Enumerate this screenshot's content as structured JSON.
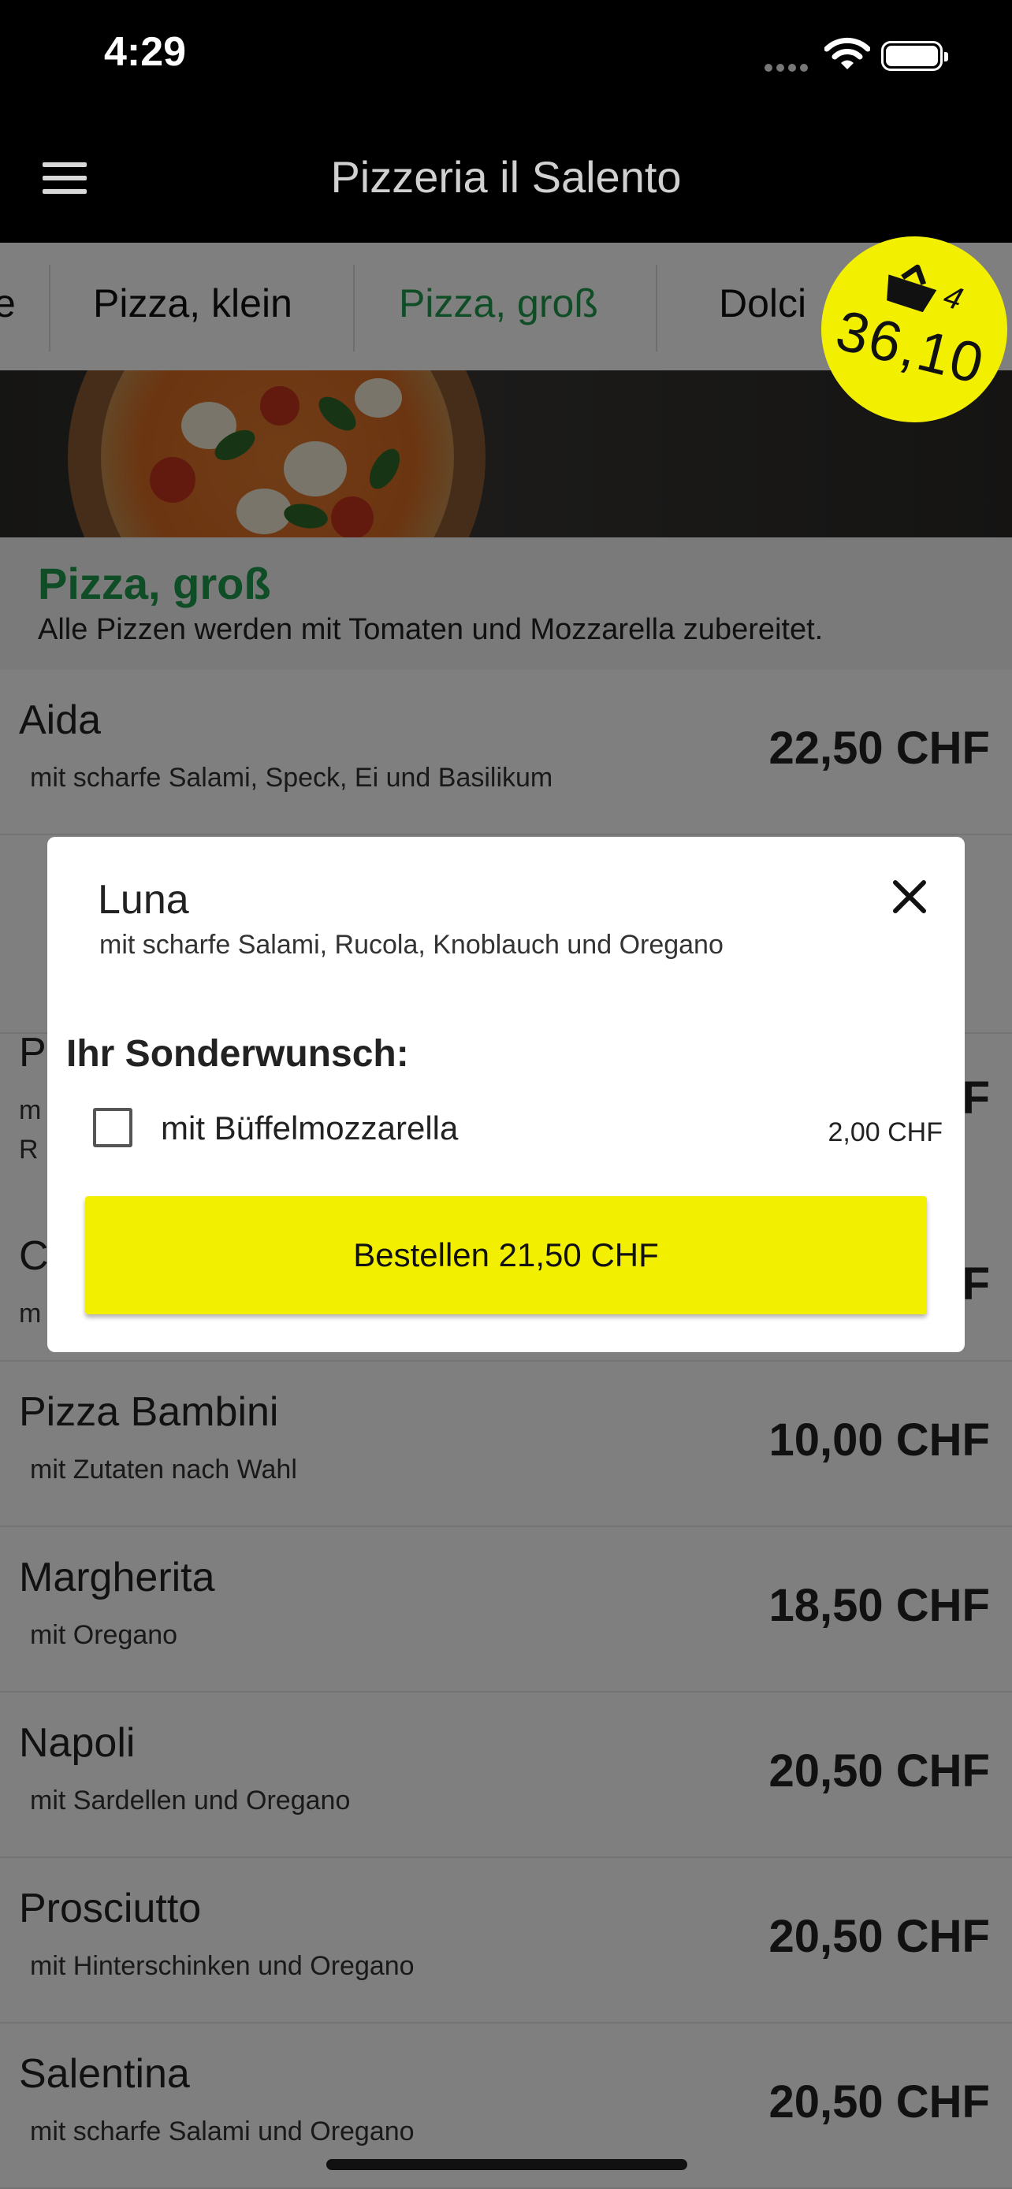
{
  "status_bar": {
    "time": "4:29"
  },
  "app_bar": {
    "title": "Pizzeria il Salento"
  },
  "tabs": [
    {
      "label": "e"
    },
    {
      "label": "Pizza, klein"
    },
    {
      "label": "Pizza, groß"
    },
    {
      "label": "Dolci"
    }
  ],
  "active_tab": 2,
  "cart": {
    "count": "4",
    "total": "36,10"
  },
  "category": {
    "name": "Pizza, groß",
    "description": "Alle Pizzen werden mit Tomaten und Mozzarella zubereitet."
  },
  "menu_items": [
    {
      "name": "Aida",
      "description": "mit scharfe Salami, Speck, Ei und Basilikum",
      "price": "22,50 CHF"
    },
    {
      "name": "P",
      "description": "m",
      "description2": "R",
      "price": "F"
    },
    {
      "name": "C",
      "description": "m",
      "price": "F"
    },
    {
      "name": "Pizza Bambini",
      "description": "mit Zutaten nach Wahl",
      "price": "10,00 CHF"
    },
    {
      "name": "Margherita",
      "description": "mit Oregano",
      "price": "18,50 CHF"
    },
    {
      "name": "Napoli",
      "description": "mit Sardellen und Oregano",
      "price": "20,50 CHF"
    },
    {
      "name": "Prosciutto",
      "description": "mit Hinterschinken und Oregano",
      "price": "20,50 CHF"
    },
    {
      "name": "Salentina",
      "description": "mit scharfe Salami und Oregano",
      "price": "20,50 CHF"
    }
  ],
  "dialog": {
    "title": "Luna",
    "subtitle": "mit scharfe Salami, Rucola, Knoblauch und Oregano",
    "section_label": "Ihr Sonderwunsch:",
    "option": {
      "label": "mit Büffelmozzarella",
      "price": "2,00 CHF",
      "checked": false
    },
    "order_button": "Bestellen 21,50 CHF"
  },
  "colors": {
    "accent_green": "#1f9a4c",
    "accent_yellow": "#f2ef00",
    "bar_black": "#000000"
  }
}
